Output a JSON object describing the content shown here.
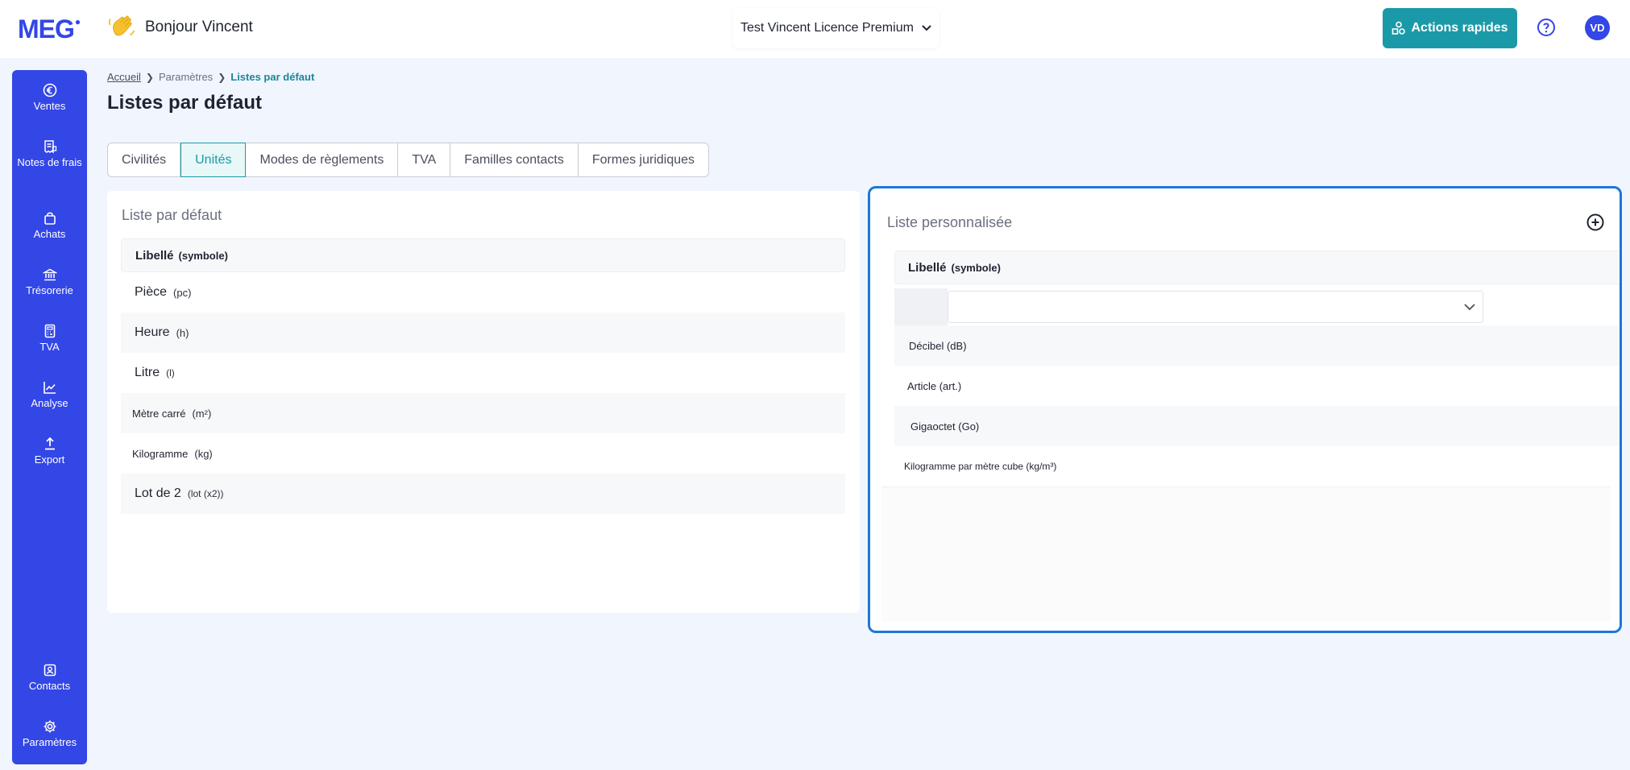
{
  "header": {
    "logo": "MEG",
    "greeting": "Bonjour Vincent",
    "company": "Test Vincent Licence Premium",
    "actions_label": "Actions rapides",
    "avatar_initials": "VD",
    "accent_color": "#1a9aa8",
    "brand_color": "#3346e6"
  },
  "sidebar": {
    "items": [
      {
        "label": "Ventes",
        "icon": "euro-icon"
      },
      {
        "label": "Notes de frais",
        "icon": "receipt-icon"
      },
      {
        "label": "Achats",
        "icon": "shopping-bag-icon"
      },
      {
        "label": "Trésorerie",
        "icon": "bank-icon"
      },
      {
        "label": "TVA",
        "icon": "calculator-icon"
      },
      {
        "label": "Analyse",
        "icon": "chart-line-icon"
      },
      {
        "label": "Export",
        "icon": "upload-icon"
      }
    ],
    "bottom_items": [
      {
        "label": "Contacts",
        "icon": "contact-card-icon"
      },
      {
        "label": "Paramètres",
        "icon": "gear-icon"
      }
    ]
  },
  "breadcrumb": {
    "home": "Accueil",
    "parent": "Paramètres",
    "current": "Listes par défaut"
  },
  "page": {
    "title": "Listes par défaut"
  },
  "tabs": [
    "Civilités",
    "Unités",
    "Modes de règlements",
    "TVA",
    "Familles contacts",
    "Formes juridiques"
  ],
  "active_tab": "Unités",
  "default_list": {
    "title": "Liste par défaut",
    "header_label": "Libellé",
    "header_symbol": "(symbole)",
    "rows": [
      {
        "label": "Pièce",
        "symbol": "(pc)"
      },
      {
        "label": "Heure",
        "symbol": "(h)"
      },
      {
        "label": "Litre",
        "symbol": "(l)"
      },
      {
        "label": "Mètre carré",
        "symbol": "(m²)"
      },
      {
        "label": "Kilogramme",
        "symbol": "(kg)"
      },
      {
        "label": "Lot de 2",
        "symbol": "(lot (x2))"
      }
    ]
  },
  "custom_list": {
    "title": "Liste personnalisée",
    "header_label": "Libellé",
    "header_symbol": "(symbole)",
    "select_value": "",
    "rows": [
      "Décibel (dB)",
      "Article (art.)",
      "Gigaoctet (Go)",
      "Kilogramme par mètre cube (kg/m³)"
    ]
  }
}
